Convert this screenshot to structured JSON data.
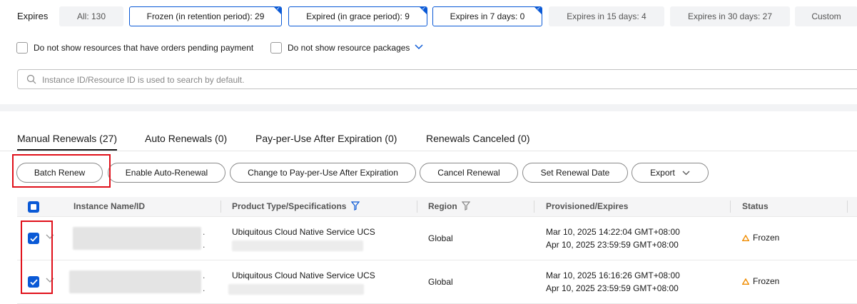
{
  "filters": {
    "expires_label": "Expires",
    "chips": [
      {
        "label": "All: 130",
        "selected": false
      },
      {
        "label": "Frozen (in retention period): 29",
        "selected": true
      },
      {
        "label": "Expired (in grace period): 9",
        "selected": true
      },
      {
        "label": "Expires in 7 days: 0",
        "selected": true
      },
      {
        "label": "Expires in 15 days: 4",
        "selected": false
      },
      {
        "label": "Expires in 30 days: 27",
        "selected": false
      },
      {
        "label": "Custom",
        "selected": false
      }
    ],
    "checkbox_pending": "Do not show resources that have orders pending payment",
    "checkbox_packages": "Do not show resource packages",
    "search_placeholder": "Instance ID/Resource ID is used to search by default."
  },
  "tabs": [
    {
      "label": "Manual Renewals (27)",
      "active": true
    },
    {
      "label": "Auto Renewals (0)",
      "active": false
    },
    {
      "label": "Pay-per-Use After Expiration (0)",
      "active": false
    },
    {
      "label": "Renewals Canceled (0)",
      "active": false
    }
  ],
  "actions": {
    "batch_renew": "Batch Renew",
    "enable_auto": "Enable Auto-Renewal",
    "change_ppu": "Change to Pay-per-Use After Expiration",
    "cancel_renewal": "Cancel Renewal",
    "set_date": "Set Renewal Date",
    "export": "Export"
  },
  "table": {
    "columns": [
      "Instance Name/ID",
      "Product Type/Specifications",
      "Region",
      "Provisioned/Expires",
      "Status"
    ],
    "rows": [
      {
        "product": "Ubiquitous Cloud Native Service UCS",
        "region": "Global",
        "provisioned": "Mar 10, 2025 14:22:04 GMT+08:00",
        "expires": "Apr 10, 2025 23:59:59 GMT+08:00",
        "status": "Frozen",
        "checked": true
      },
      {
        "product": "Ubiquitous Cloud Native Service UCS",
        "region": "Global",
        "provisioned": "Mar 10, 2025 16:16:26 GMT+08:00",
        "expires": "Apr 10, 2025 23:59:59 GMT+08:00",
        "status": "Frozen",
        "checked": true
      }
    ]
  },
  "colors": {
    "accent": "#0a59d6",
    "highlight": "#e0101a",
    "warning": "#f08c00"
  }
}
